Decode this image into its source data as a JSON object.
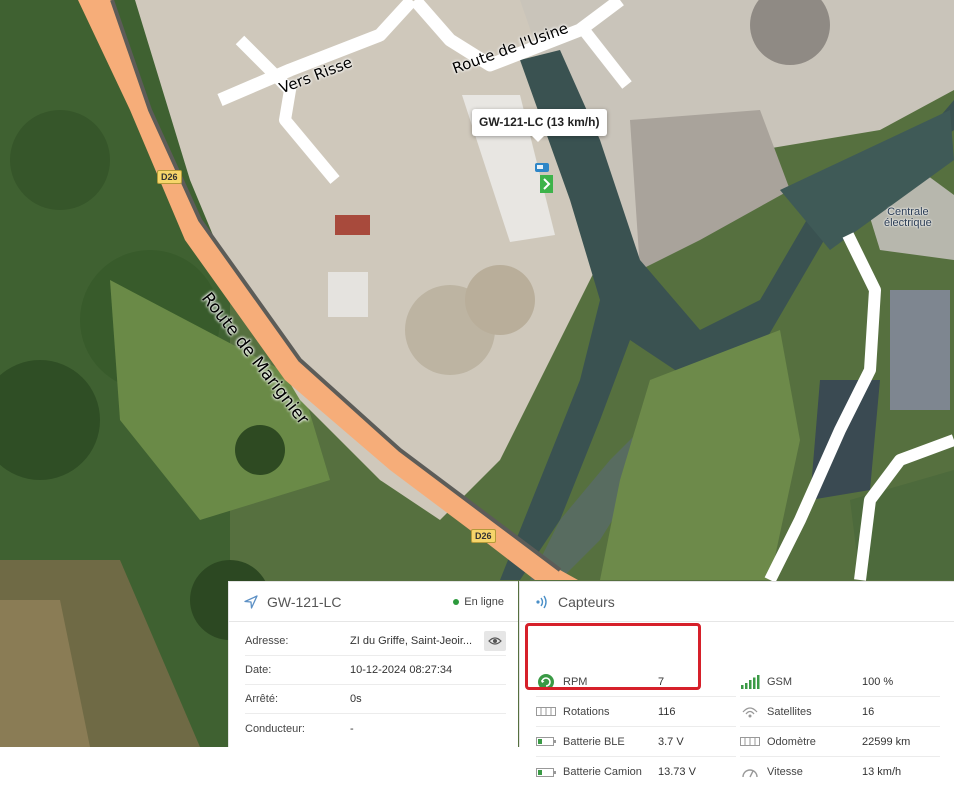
{
  "map": {
    "roads": {
      "vers_risse": "Vers Risse",
      "route_usine": "Route de l'Usine",
      "route_marignier": "Route de Marignier",
      "shield_1": "D26",
      "shield_2": "D26"
    },
    "place": {
      "line1": "Centrale",
      "line2": "électrique"
    },
    "vehicle_tooltip": "GW-121-LC (13 km/h)",
    "colors": {
      "main_road": "#f6ad79",
      "minor_road": "#ffffff",
      "forest": "#4a6b35",
      "industrial": "#cfc8bb"
    }
  },
  "vehicle_panel": {
    "title": "GW-121-LC",
    "status": "En ligne",
    "rows": [
      {
        "label": "Adresse:",
        "value": "ZI du Griffe, Saint-Jeoir..."
      },
      {
        "label": "Date:",
        "value": "10-12-2024 08:27:34"
      },
      {
        "label": "Arrêté:",
        "value": "0s"
      },
      {
        "label": "Conducteur:",
        "value": "-"
      }
    ]
  },
  "sensor_panel": {
    "title": "Capteurs",
    "left": [
      {
        "label": "RPM",
        "value": "7",
        "icon": "rpm-icon"
      },
      {
        "label": "Rotations",
        "value": "116",
        "icon": "counter-icon"
      },
      {
        "label": "Batterie BLE",
        "value": "3.7 V",
        "icon": "battery-icon"
      },
      {
        "label": "Batterie Camion",
        "value": "13.73 V",
        "icon": "battery-icon"
      }
    ],
    "right": [
      {
        "label": "GSM",
        "value": "100 %",
        "icon": "signal-bars-icon"
      },
      {
        "label": "Satellites",
        "value": "16",
        "icon": "satellite-icon"
      },
      {
        "label": "Odomètre",
        "value": "22599 km",
        "icon": "counter-icon"
      },
      {
        "label": "Vitesse",
        "value": "13 km/h",
        "icon": "speedometer-icon"
      }
    ]
  },
  "highlight_color": "#d6202a"
}
